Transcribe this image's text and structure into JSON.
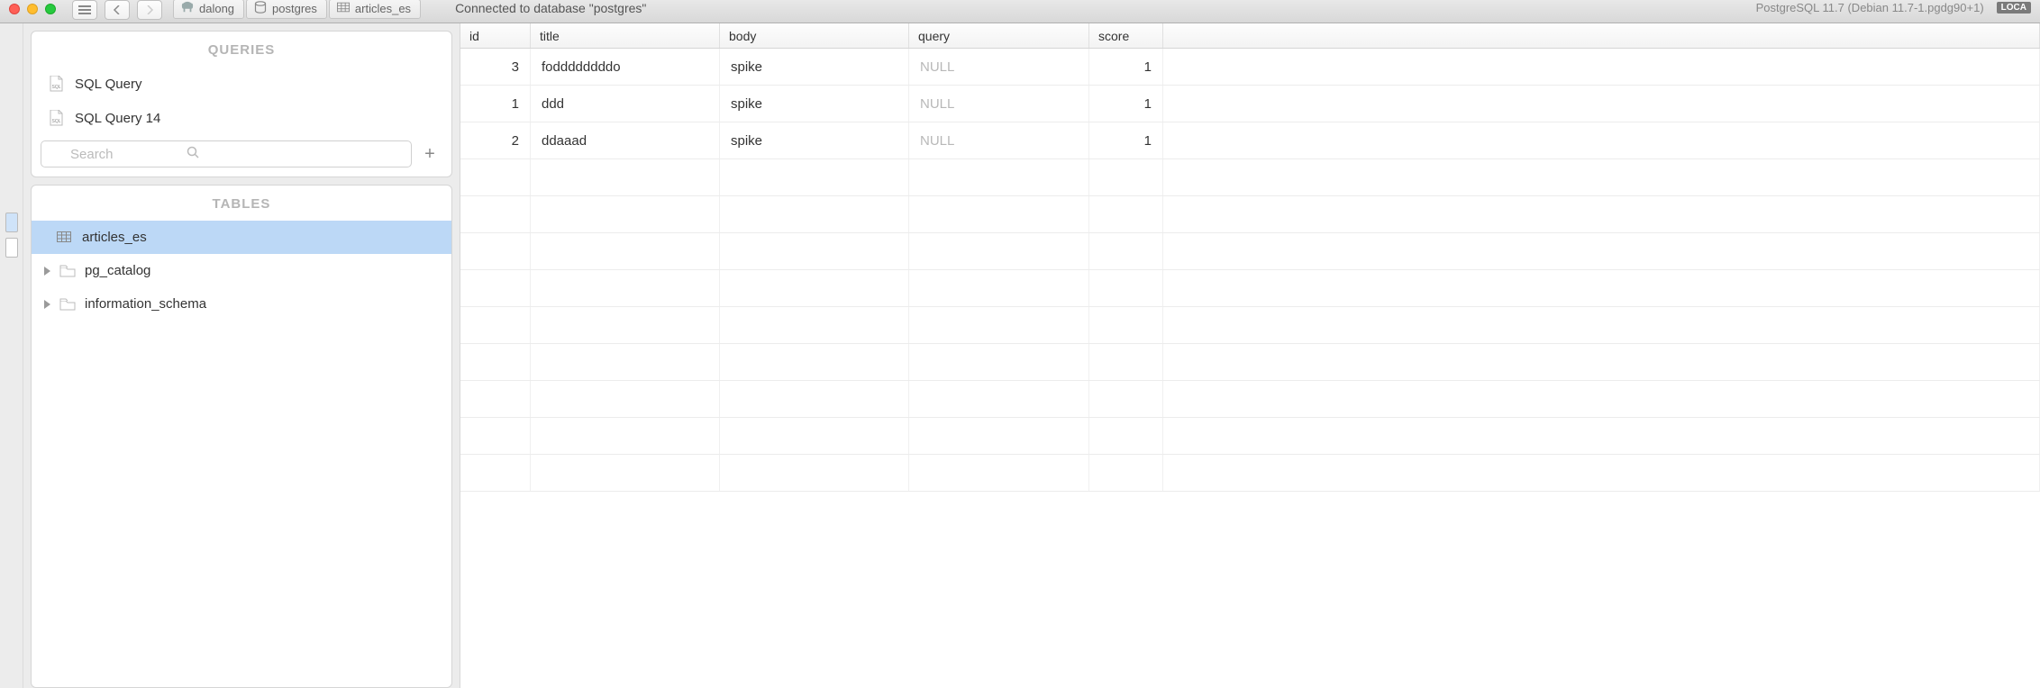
{
  "toolbar": {
    "breadcrumbs": [
      {
        "label": "dalong",
        "icon": "elephant"
      },
      {
        "label": "postgres",
        "icon": "database"
      },
      {
        "label": "articles_es",
        "icon": "table"
      }
    ],
    "status": "Connected to database \"postgres\"",
    "server_version": "PostgreSQL 11.7 (Debian 11.7-1.pgdg90+1)",
    "badge": "LOCA"
  },
  "sidebar": {
    "queries_header": "QUERIES",
    "queries": [
      {
        "label": "SQL Query"
      },
      {
        "label": "SQL Query 14"
      }
    ],
    "search_placeholder": "Search",
    "tables_header": "TABLES",
    "tables": [
      {
        "label": "articles_es",
        "kind": "table",
        "selected": true
      },
      {
        "label": "pg_catalog",
        "kind": "schema",
        "selected": false
      },
      {
        "label": "information_schema",
        "kind": "schema",
        "selected": false
      }
    ]
  },
  "grid": {
    "columns": [
      "id",
      "title",
      "body",
      "query",
      "score"
    ],
    "rows": [
      {
        "id": "3",
        "title": "foddddddddo",
        "body": "spike",
        "query": null,
        "score": "1"
      },
      {
        "id": "1",
        "title": "ddd",
        "body": "spike",
        "query": null,
        "score": "1"
      },
      {
        "id": "2",
        "title": "ddaaad",
        "body": "spike",
        "query": null,
        "score": "1"
      }
    ],
    "null_label": "NULL",
    "empty_rows": 9
  }
}
